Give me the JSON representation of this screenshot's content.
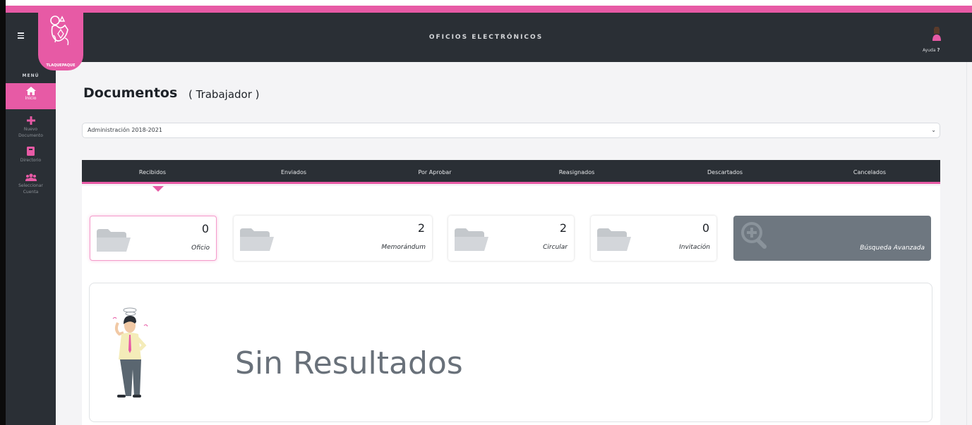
{
  "header": {
    "app_title": "OFICIOS ELECTRÓNICOS",
    "logo_text": "TLAQUEPAQUE",
    "help_label": "Ayuda",
    "help_mark": "?"
  },
  "sidebar": {
    "menu_heading": "MENÚ",
    "items": [
      {
        "label": "Inicio",
        "icon": "home-icon",
        "active": true
      },
      {
        "label": "Nuevo Documento",
        "icon": "plus-icon",
        "active": false
      },
      {
        "label": "Directorio",
        "icon": "book-icon",
        "active": false
      },
      {
        "label": "Seleccionar Cuenta",
        "icon": "users-icon",
        "active": false
      }
    ]
  },
  "page": {
    "title": "Documentos",
    "subtitle": "( Trabajador )"
  },
  "filter": {
    "selected": "Administración 2018-2021"
  },
  "tabs": [
    {
      "label": "Recibidos",
      "active": true
    },
    {
      "label": "Enviados",
      "active": false
    },
    {
      "label": "Por Aprobar",
      "active": false
    },
    {
      "label": "Reasignados",
      "active": false
    },
    {
      "label": "Descartados",
      "active": false
    },
    {
      "label": "Cancelados",
      "active": false
    }
  ],
  "cards": [
    {
      "count": "0",
      "label": "Oficio",
      "selected": true
    },
    {
      "count": "2",
      "label": "Memorándum",
      "selected": false
    },
    {
      "count": "2",
      "label": "Circular",
      "selected": false
    },
    {
      "count": "0",
      "label": "Invitación",
      "selected": false
    }
  ],
  "advanced_search": {
    "label": "Búsqueda Avanzada"
  },
  "results": {
    "message": "Sin Resultados"
  },
  "colors": {
    "accent": "#e75aa5",
    "dark": "#2a2f35",
    "muted": "#6e7780"
  }
}
